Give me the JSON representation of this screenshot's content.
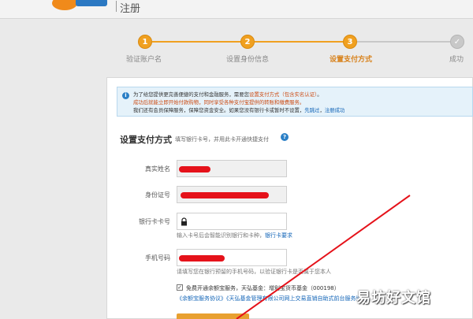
{
  "header": {
    "title": "注册"
  },
  "steps": [
    {
      "number": "1",
      "label": "验证账户名"
    },
    {
      "number": "2",
      "label": "设置身份信息"
    },
    {
      "number": "3",
      "label": "设置支付方式"
    },
    {
      "number": "✓",
      "label": "成功"
    }
  ],
  "notice": {
    "line1_a": "为了给您提供更完善便捷的支付和金融服务，需要您",
    "line1_em": "设置支付方式（包含实名认证）",
    "line1_b": "。",
    "line2": "成功后就能立即开始付款购物，同时享受各种支付宝提供的转账和缴费服务。",
    "line3_a": "我们还有会员保障服务，保障您资金安全。如果您没有银行卡或暂时不设置，",
    "line3_link1": "先跳过",
    "line3_sep": "，",
    "line3_link2": "注册成功"
  },
  "form": {
    "title": "设置支付方式",
    "hint": "填写银行卡号，并用此卡开通快捷支付",
    "real_name_label": "真实姓名",
    "id_label": "身份证号",
    "card_label": "银行卡卡号",
    "card_hint_a": "输入卡号后会智能识别银行和卡种，",
    "card_hint_link": "银行卡要求",
    "phone_label": "手机号码",
    "phone_hint": "请填写您在银行预留的手机号码，以验证银行卡是否属于您本人",
    "agree_line1": "免费开通余额宝服务，天弘基金：增利宝货币基金（000198）",
    "agree_line2": "《余额宝服务协议》《天弘基金管理有限公司网上交易直销自助式前台服务协议》"
  },
  "watermark": "易坊好文馆",
  "colors": {
    "accent": "#f0a020",
    "redaction": "#e5121a",
    "link": "#1466b8",
    "notice_bg": "#e5f2fa"
  }
}
